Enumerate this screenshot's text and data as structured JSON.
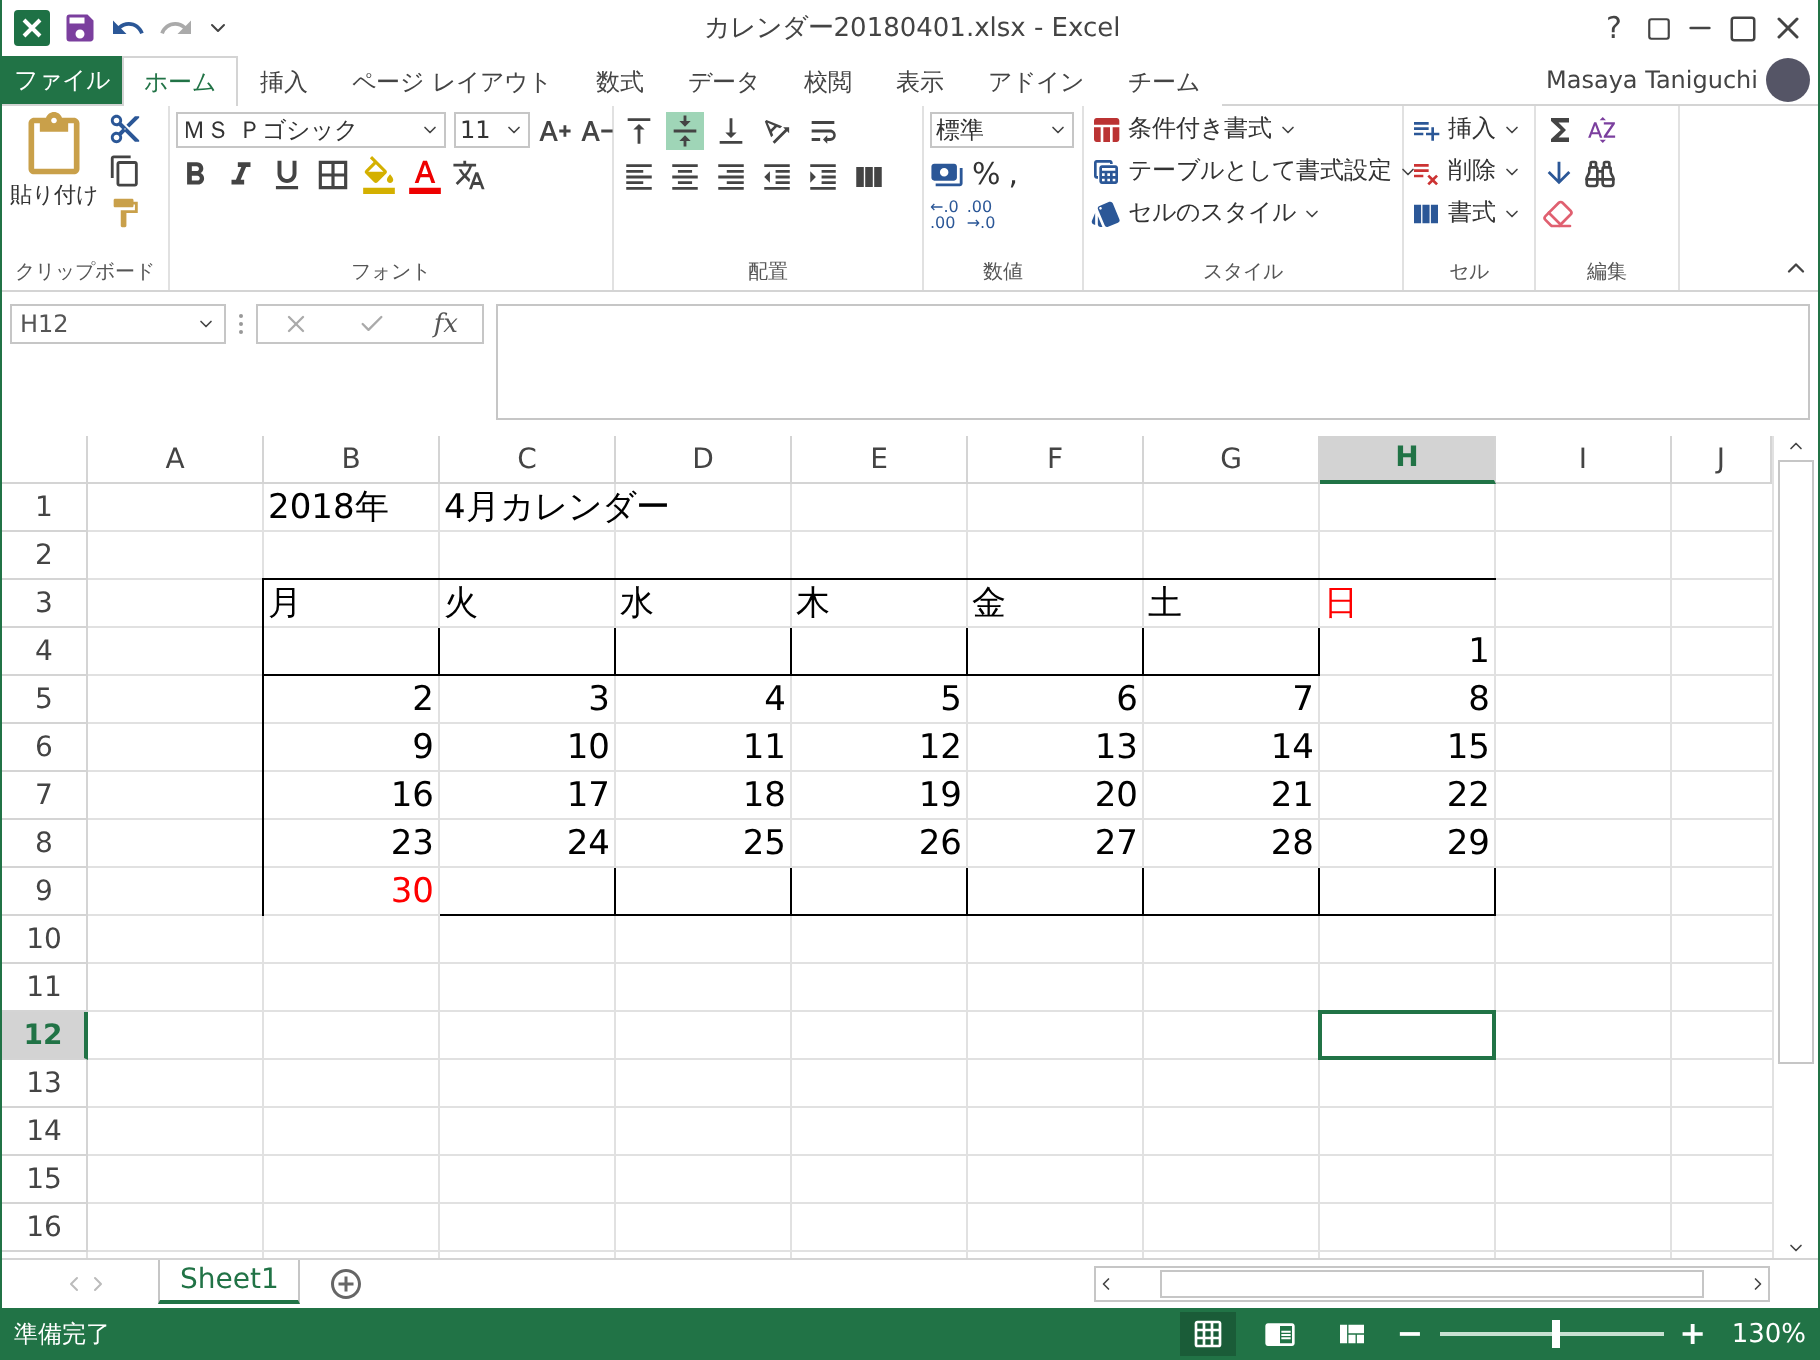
{
  "title_bar": {
    "title": "カレンダー20180401.xlsx - Excel",
    "help": "?"
  },
  "tabs": [
    {
      "label": "ファイル",
      "kind": "file",
      "selected": false
    },
    {
      "label": "ホーム",
      "kind": "tab",
      "selected": true
    },
    {
      "label": "挿入",
      "kind": "tab",
      "selected": false
    },
    {
      "label": "ページ レイアウト",
      "kind": "tab",
      "selected": false
    },
    {
      "label": "数式",
      "kind": "tab",
      "selected": false
    },
    {
      "label": "データ",
      "kind": "tab",
      "selected": false
    },
    {
      "label": "校閲",
      "kind": "tab",
      "selected": false
    },
    {
      "label": "表示",
      "kind": "tab",
      "selected": false
    },
    {
      "label": "アドイン",
      "kind": "tab",
      "selected": false
    },
    {
      "label": "チーム",
      "kind": "tab",
      "selected": false
    }
  ],
  "user": "Masaya Taniguchi",
  "ribbon": {
    "paste_label": "貼り付け",
    "font_name": "ＭＳ Ｐゴシック",
    "font_size": "11",
    "number_format": "標準",
    "number_symbols": [
      "%",
      ","
    ],
    "decimal_increase": [
      "←.0",
      ".00"
    ],
    "decimal_decrease": [
      ".00",
      "→.0"
    ],
    "style_items": [
      "条件付き書式",
      "テーブルとして書式設定",
      "セルのスタイル"
    ],
    "cell_items": [
      "挿入",
      "削除",
      "書式"
    ],
    "groups": [
      "クリップボード",
      "フォント",
      "配置",
      "数値",
      "スタイル",
      "セル",
      "編集"
    ]
  },
  "formula_bar": {
    "name_box": "H12",
    "fx": "fx"
  },
  "columns": [
    {
      "label": "A",
      "selected": false
    },
    {
      "label": "B",
      "selected": false
    },
    {
      "label": "C",
      "selected": false
    },
    {
      "label": "D",
      "selected": false
    },
    {
      "label": "E",
      "selected": false
    },
    {
      "label": "F",
      "selected": false
    },
    {
      "label": "G",
      "selected": false
    },
    {
      "label": "H",
      "selected": true
    },
    {
      "label": "I",
      "selected": false
    },
    {
      "label": "J",
      "selected": false
    }
  ],
  "rows": [
    {
      "label": "1",
      "selected": false
    },
    {
      "label": "2",
      "selected": false
    },
    {
      "label": "3",
      "selected": false
    },
    {
      "label": "4",
      "selected": false
    },
    {
      "label": "5",
      "selected": false
    },
    {
      "label": "6",
      "selected": false
    },
    {
      "label": "7",
      "selected": false
    },
    {
      "label": "8",
      "selected": false
    },
    {
      "label": "9",
      "selected": false
    },
    {
      "label": "10",
      "selected": false
    },
    {
      "label": "11",
      "selected": false
    },
    {
      "label": "12",
      "selected": true
    },
    {
      "label": "13",
      "selected": false
    },
    {
      "label": "14",
      "selected": false
    },
    {
      "label": "15",
      "selected": false
    },
    {
      "label": "16",
      "selected": false
    }
  ],
  "calendar": {
    "title_cells": [
      "2018年",
      "4月カレンダー"
    ],
    "header": [
      {
        "text": "月",
        "color": "#000000"
      },
      {
        "text": "火",
        "color": "#000000"
      },
      {
        "text": "水",
        "color": "#000000"
      },
      {
        "text": "木",
        "color": "#000000"
      },
      {
        "text": "金",
        "color": "#000000"
      },
      {
        "text": "土",
        "color": "#000000"
      },
      {
        "text": "日",
        "color": "#ff0000"
      }
    ],
    "weeks": [
      [
        {
          "kind": "blank"
        },
        {
          "kind": "blank"
        },
        {
          "kind": "blank"
        },
        {
          "kind": "blank"
        },
        {
          "kind": "blank"
        },
        {
          "kind": "blank"
        },
        {
          "kind": "day",
          "text": "1",
          "color": "#000000"
        }
      ],
      [
        {
          "kind": "day",
          "text": "2",
          "color": "#000000"
        },
        {
          "kind": "day",
          "text": "3",
          "color": "#000000"
        },
        {
          "kind": "day",
          "text": "4",
          "color": "#000000"
        },
        {
          "kind": "day",
          "text": "5",
          "color": "#000000"
        },
        {
          "kind": "day",
          "text": "6",
          "color": "#000000"
        },
        {
          "kind": "day",
          "text": "7",
          "color": "#000000"
        },
        {
          "kind": "day",
          "text": "8",
          "color": "#000000"
        }
      ],
      [
        {
          "kind": "day",
          "text": "9",
          "color": "#000000"
        },
        {
          "kind": "day",
          "text": "10",
          "color": "#000000"
        },
        {
          "kind": "day",
          "text": "11",
          "color": "#000000"
        },
        {
          "kind": "day",
          "text": "12",
          "color": "#000000"
        },
        {
          "kind": "day",
          "text": "13",
          "color": "#000000"
        },
        {
          "kind": "day",
          "text": "14",
          "color": "#000000"
        },
        {
          "kind": "day",
          "text": "15",
          "color": "#000000"
        }
      ],
      [
        {
          "kind": "day",
          "text": "16",
          "color": "#000000"
        },
        {
          "kind": "day",
          "text": "17",
          "color": "#000000"
        },
        {
          "kind": "day",
          "text": "18",
          "color": "#000000"
        },
        {
          "kind": "day",
          "text": "19",
          "color": "#000000"
        },
        {
          "kind": "day",
          "text": "20",
          "color": "#000000"
        },
        {
          "kind": "day",
          "text": "21",
          "color": "#000000"
        },
        {
          "kind": "day",
          "text": "22",
          "color": "#000000"
        }
      ],
      [
        {
          "kind": "day",
          "text": "23",
          "color": "#000000"
        },
        {
          "kind": "day",
          "text": "24",
          "color": "#000000"
        },
        {
          "kind": "day",
          "text": "25",
          "color": "#000000"
        },
        {
          "kind": "day",
          "text": "26",
          "color": "#000000"
        },
        {
          "kind": "day",
          "text": "27",
          "color": "#000000"
        },
        {
          "kind": "day",
          "text": "28",
          "color": "#000000"
        },
        {
          "kind": "day",
          "text": "29",
          "color": "#000000"
        }
      ],
      [
        {
          "kind": "day",
          "text": "30",
          "color": "#ff0000"
        },
        {
          "kind": "blank"
        },
        {
          "kind": "blank"
        },
        {
          "kind": "blank"
        },
        {
          "kind": "blank"
        },
        {
          "kind": "blank"
        },
        {
          "kind": "blank"
        }
      ]
    ]
  },
  "sheet_tabs": [
    {
      "label": "Sheet1",
      "selected": true
    }
  ],
  "status_bar": {
    "status": "準備完了",
    "views": [
      {
        "kind": "normal",
        "selected": true
      },
      {
        "kind": "page_layout",
        "selected": false
      },
      {
        "kind": "page_break",
        "selected": false
      }
    ],
    "zoom": {
      "zoom_out": "−",
      "zoom_in": "+",
      "level": 0.52,
      "reading": "130%"
    }
  }
}
